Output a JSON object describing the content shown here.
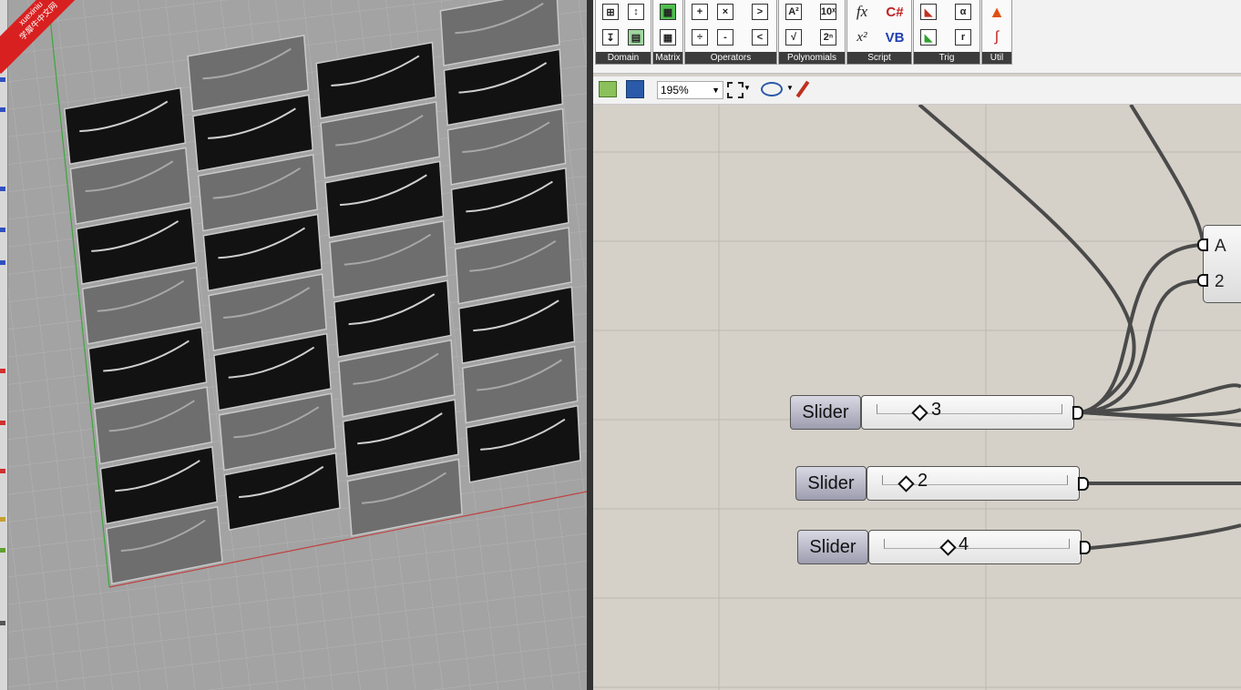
{
  "watermark": {
    "line1": "xuexiniu",
    "line2": "学犀牛中文网"
  },
  "ribbon": {
    "panels": [
      {
        "name": "Domain"
      },
      {
        "name": "Matrix"
      },
      {
        "name": "Operators"
      },
      {
        "name": "Polynomials"
      },
      {
        "name": "Script"
      },
      {
        "name": "Trig"
      },
      {
        "name": "Util"
      }
    ],
    "operator_glyphs": [
      "+",
      "×",
      ">",
      "÷",
      "-",
      "<"
    ],
    "polynomial_glyphs": [
      "A²",
      "10ˣ",
      "√",
      "2ⁿ"
    ],
    "script_glyphs": [
      "fx",
      "C#",
      "x²",
      "VB"
    ],
    "trig_glyphs": [
      "α",
      "r"
    ]
  },
  "toolbar": {
    "zoom": "195%"
  },
  "sliders": [
    {
      "label": "Slider",
      "value": "3"
    },
    {
      "label": "Slider",
      "value": "2"
    },
    {
      "label": "Slider",
      "value": "4"
    }
  ],
  "component": {
    "inputs": [
      "A",
      "2"
    ]
  },
  "colors": {
    "canvas": "#d5d1c9",
    "wire": "#4a4a4a",
    "panel_caption": "#3c3c3c",
    "watermark": "#d92020"
  }
}
